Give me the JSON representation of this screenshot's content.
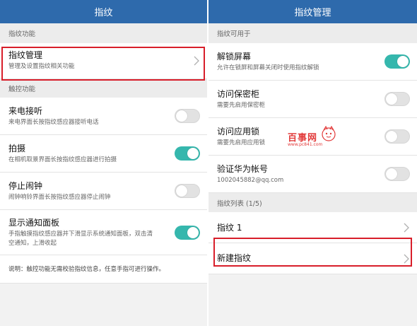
{
  "left": {
    "title": "指纹",
    "sections": {
      "fingerprint": "指纹功能",
      "touch": "触控功能"
    },
    "manage": {
      "title": "指纹管理",
      "sub": "管理及设置指纹相关功能"
    },
    "touch_items": [
      {
        "title": "来电接听",
        "sub": "来电界面长按指纹感应器接听电话",
        "state": "off"
      },
      {
        "title": "拍摄",
        "sub": "在相机取景界面长按指纹感应器进行拍摄",
        "state": "on"
      },
      {
        "title": "停止闹钟",
        "sub": "闹钟响铃界面长按指纹感应器停止闹钟",
        "state": "off"
      },
      {
        "title": "显示通知面板",
        "sub1": "手指触摸指纹感应器并下滑显示系统通知面板，双击清",
        "sub2": "空通知，上滑收起",
        "state": "on"
      }
    ],
    "note": "说明：触控功能无需校验指纹信息，任意手指可进行操作。"
  },
  "right": {
    "title": "指纹管理",
    "sections": {
      "usage": "指纹可用于",
      "list": "指纹列表 (1/5)"
    },
    "usage_items": [
      {
        "title": "解锁屏幕",
        "sub": "允许在锁屏和屏幕关闭时使用指纹解锁",
        "state": "on"
      },
      {
        "title": "访问保密柜",
        "sub": "需要先启用保密柜",
        "state": "off"
      },
      {
        "title": "访问应用锁",
        "sub": "需要先启用应用锁",
        "state": "off"
      },
      {
        "title": "验证华为帐号",
        "sub": "1002045882@qq.com",
        "state": "off"
      }
    ],
    "list_items": [
      {
        "title": "指纹 1"
      },
      {
        "title": "新建指纹"
      }
    ]
  },
  "watermark": {
    "title": "百事网",
    "sub": "www.pc841.com"
  },
  "colors": {
    "titlebar": "#2e6aac",
    "toggle_on": "#35b7ad",
    "highlight": "#d81e2a"
  },
  "icons": {
    "chevron": "chevron-right-icon",
    "mascot": "mascot-logo"
  }
}
